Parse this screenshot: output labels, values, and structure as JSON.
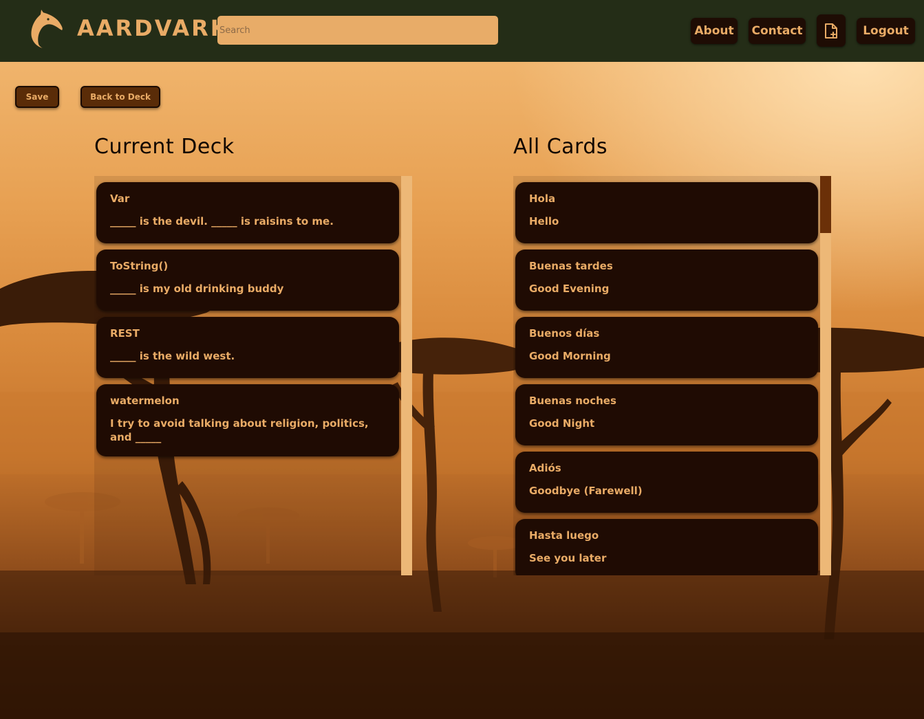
{
  "header": {
    "brand": "AARDVARK",
    "search_placeholder": "Search",
    "nav": {
      "about": "About",
      "contact": "Contact",
      "logout": "Logout"
    }
  },
  "actions": {
    "save": "Save",
    "back_to_deck": "Back to Deck"
  },
  "current_deck": {
    "title": "Current Deck",
    "cards": [
      {
        "front": "Var",
        "back": "_____ is the devil. _____ is raisins to me."
      },
      {
        "front": "ToString()",
        "back": "_____ is my old drinking buddy"
      },
      {
        "front": "REST",
        "back": "_____ is the wild west."
      },
      {
        "front": "watermelon",
        "back": "I try to avoid talking about religion, politics, and _____"
      }
    ]
  },
  "all_cards": {
    "title": "All Cards",
    "cards": [
      {
        "front": "Hola",
        "back": "Hello"
      },
      {
        "front": "Buenas tardes",
        "back": "Good Evening"
      },
      {
        "front": "Buenos días",
        "back": "Good Morning"
      },
      {
        "front": "Buenas noches",
        "back": "Good Night"
      },
      {
        "front": "Adiós",
        "back": "Goodbye (Farewell)"
      },
      {
        "front": "Hasta luego",
        "back": "See you later"
      }
    ]
  },
  "colors": {
    "header_bg": "#242d17",
    "accent": "#e9ab66",
    "card_bg": "#1f0b03",
    "button_bg": "#5a2c08"
  }
}
